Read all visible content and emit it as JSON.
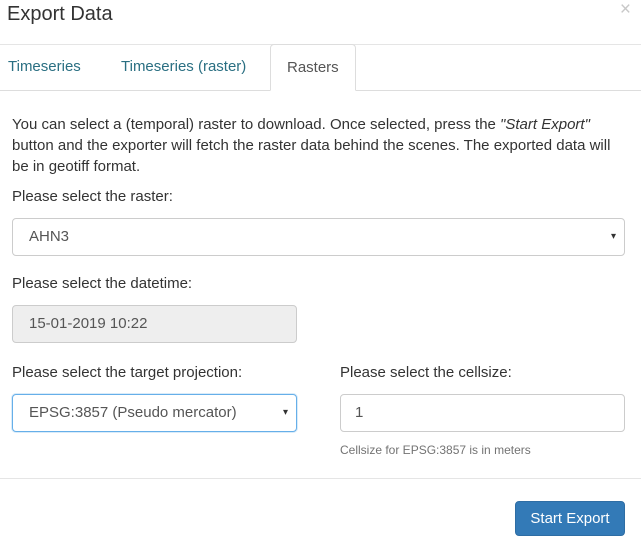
{
  "modal": {
    "title": "Export Data",
    "close_glyph": "×"
  },
  "tabs": [
    {
      "label": "Timeseries"
    },
    {
      "label": "Timeseries (raster)"
    },
    {
      "label": "Rasters"
    }
  ],
  "intro": {
    "part1": "You can select a (temporal) raster to download. Once selected, press the ",
    "emphasis": "\"Start Export\"",
    "part2": " button and the exporter will fetch the raster data behind the scenes. The exported data will be in geotiff format."
  },
  "raster": {
    "label": "Please select the raster:",
    "value": "AHN3"
  },
  "datetime": {
    "label": "Please select the datetime:",
    "value": "15-01-2019 10:22"
  },
  "projection": {
    "label": "Please select the target projection:",
    "value": "EPSG:3857 (Pseudo mercator)"
  },
  "cellsize": {
    "label": "Please select the cellsize:",
    "value": "1",
    "help": "Cellsize for EPSG:3857 is in meters"
  },
  "footer": {
    "start_export": "Start Export"
  },
  "icons": {
    "caret": "▾"
  }
}
